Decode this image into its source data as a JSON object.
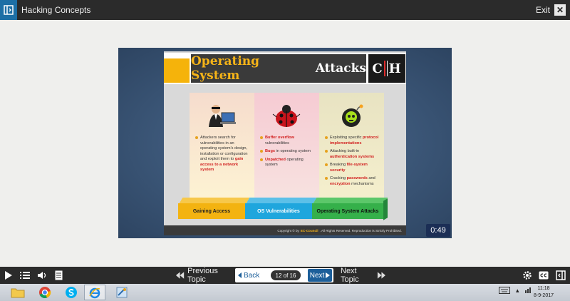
{
  "topbar": {
    "title": "Hacking Concepts",
    "exit_label": "Exit",
    "close_glyph": "✕"
  },
  "slide": {
    "title_part1": "Operating System",
    "title_part2": "Attacks",
    "logo_text_left": "C",
    "logo_text_right": "H",
    "columns": [
      {
        "icon": "hacker-computer-icon",
        "bullets": [
          {
            "text": "Attackers search for vulnerabilities in an operating system's design, installation or configuration and exploit them to ",
            "highlight": "gain access to a network system"
          }
        ]
      },
      {
        "icon": "ladybug-icon",
        "bullets": [
          {
            "highlight": "Buffer overflow",
            "text": " vulnerabilities"
          },
          {
            "highlight": "Bugs",
            "text": " in operating system"
          },
          {
            "highlight": "Unpatched",
            "text": " operating system"
          }
        ]
      },
      {
        "icon": "skull-bomb-icon",
        "bullets": [
          {
            "text": "Exploiting specific ",
            "highlight": "protocol implementations"
          },
          {
            "text": "Attacking built-in ",
            "highlight": "authentication systems"
          },
          {
            "text": "Breaking ",
            "highlight": "file-system security"
          },
          {
            "text": "Cracking ",
            "highlight": "passwords",
            "text2": " and ",
            "highlight2": "encryption",
            "text3": " mechanisms"
          }
        ]
      }
    ],
    "blocks": [
      "Gaining Access",
      "OS Vulnerabilities",
      "Operating System Attacks"
    ],
    "footer_prefix": "Copyright © by",
    "footer_brand": "EC-Council",
    "footer_suffix": ". All Rights Reserved. Reproduction is Strictly Prohibited."
  },
  "timer": "0:49",
  "controls": {
    "previous_label": "Previous Topic",
    "back_label": "Back",
    "page_indicator": "12 of 16",
    "next_label": "Next",
    "next_topic_label": "Next Topic"
  },
  "taskbar": {
    "time": "11:18",
    "date": "8-9-2017"
  },
  "colors": {
    "accent": "#1d5f9a",
    "title_gold": "#f6b418",
    "gaining": "#f3b311",
    "vuln": "#1fa6dd",
    "attacks": "#35b04a"
  }
}
